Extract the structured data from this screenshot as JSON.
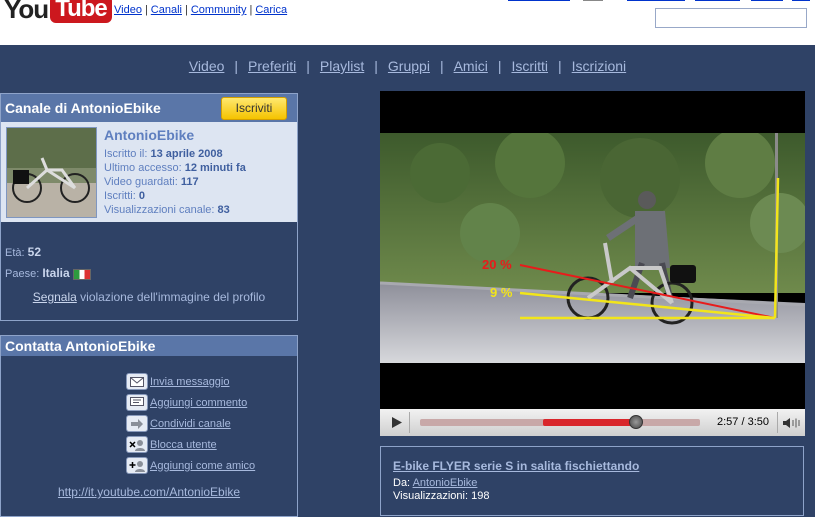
{
  "logo": {
    "you": "You",
    "tube": "Tube"
  },
  "topnav": [
    "Video",
    "Canali",
    "Community",
    "Carica"
  ],
  "search": {
    "value": ""
  },
  "channel_nav": [
    "Video",
    "Preferiti",
    "Playlist",
    "Gruppi",
    "Amici",
    "Iscritti",
    "Iscrizioni"
  ],
  "profile": {
    "header": "Canale di AntonioEbike",
    "subscribe_label": "Iscriviti",
    "username": "AntonioEbike",
    "stats": [
      {
        "label": "Iscritto il:",
        "value": "13 aprile 2008"
      },
      {
        "label": "Ultimo accesso:",
        "value": "12 minuti fa"
      },
      {
        "label": "Video guardati:",
        "value": "117"
      },
      {
        "label": "Iscritti:",
        "value": "0"
      },
      {
        "label": "Visualizzazioni canale:",
        "value": "83"
      }
    ],
    "age_label": "Età:",
    "age": "52",
    "country_label": "Paese:",
    "country": "Italia",
    "report_link": "Segnala",
    "report_text": " violazione dell'immagine del profilo"
  },
  "contact": {
    "header": "Contatta AntonioEbike",
    "actions": [
      {
        "label": "Invia messaggio",
        "icon": "mail-icon"
      },
      {
        "label": "Aggiungi commento",
        "icon": "comment-icon"
      },
      {
        "label": "Condividi canale",
        "icon": "share-icon"
      },
      {
        "label": "Blocca utente",
        "icon": "block-user-icon"
      },
      {
        "label": "Aggiungi come amico",
        "icon": "add-friend-icon"
      }
    ],
    "channel_url": "http://it.youtube.com/AntonioEbike"
  },
  "player": {
    "overlay_labels": [
      "20 %",
      "9 %"
    ],
    "time": "2:57 / 3:50",
    "progress": 0.77,
    "elapsed_fraction": 0.77
  },
  "video": {
    "title": "E-bike FLYER serie S in salita fischiettando",
    "by_label": "Da:",
    "by": "AntonioEbike",
    "views_label": "Visualizzazioni:",
    "views": "198"
  },
  "colors": {
    "brand_red": "#cc181e",
    "page_bg": "#2f4266",
    "header_bg": "#5a76a8",
    "link": "#a7b9dd"
  }
}
